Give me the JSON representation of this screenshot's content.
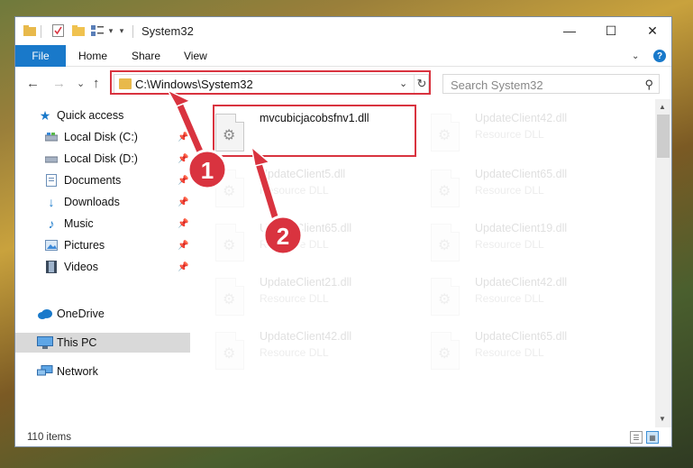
{
  "window": {
    "title": "System32",
    "controls": {
      "minimize": "—",
      "maximize": "☐",
      "close": "✕"
    }
  },
  "quick_access_toolbar": {
    "dropdown_glyph": "▾"
  },
  "ribbon": {
    "tabs": [
      "File",
      "Home",
      "Share",
      "View"
    ],
    "expand_glyph": "⌄",
    "help_glyph": "?"
  },
  "navigation": {
    "back": "←",
    "forward": "→",
    "recent": "⌄",
    "up": "↑",
    "address": "C:\\Windows\\System32",
    "address_dropdown": "⌄",
    "refresh": "↻",
    "search_placeholder": "Search System32",
    "search_glyph": "⚲"
  },
  "sidebar": {
    "quick_access": "Quick access",
    "items": [
      {
        "label": "Local Disk (C:)",
        "icon": "drive-icon",
        "pinned": true
      },
      {
        "label": "Local Disk (D:)",
        "icon": "drive-icon",
        "pinned": true
      },
      {
        "label": "Documents",
        "icon": "documents-icon",
        "pinned": true
      },
      {
        "label": "Downloads",
        "icon": "downloads-icon",
        "pinned": true
      },
      {
        "label": "Music",
        "icon": "music-icon",
        "pinned": true
      },
      {
        "label": "Pictures",
        "icon": "pictures-icon",
        "pinned": true
      },
      {
        "label": "Videos",
        "icon": "videos-icon",
        "pinned": true
      }
    ],
    "onedrive": "OneDrive",
    "this_pc": "This PC",
    "network": "Network",
    "pin_glyph": "📌"
  },
  "files": {
    "type_label": "Resource DLL",
    "featured": {
      "name": "mvcubicjacobsfnv1.dll"
    },
    "right_column": [
      "UpdateClient42.dll",
      "UpdateClient65.dll",
      "UpdateClient19.dll",
      "UpdateClient42.dll",
      "UpdateClient65.dll"
    ],
    "left_column": [
      "UpdateClient5.dll",
      "UpdateClient65.dll",
      "UpdateClient21.dll",
      "UpdateClient42.dll"
    ]
  },
  "status": {
    "item_count": "110 items"
  },
  "annotations": {
    "step1": "1",
    "step2": "2",
    "color": "#d9333f"
  },
  "colors": {
    "accent": "#1979ca",
    "highlight": "#d9333f",
    "folder": "#e8b94b"
  }
}
